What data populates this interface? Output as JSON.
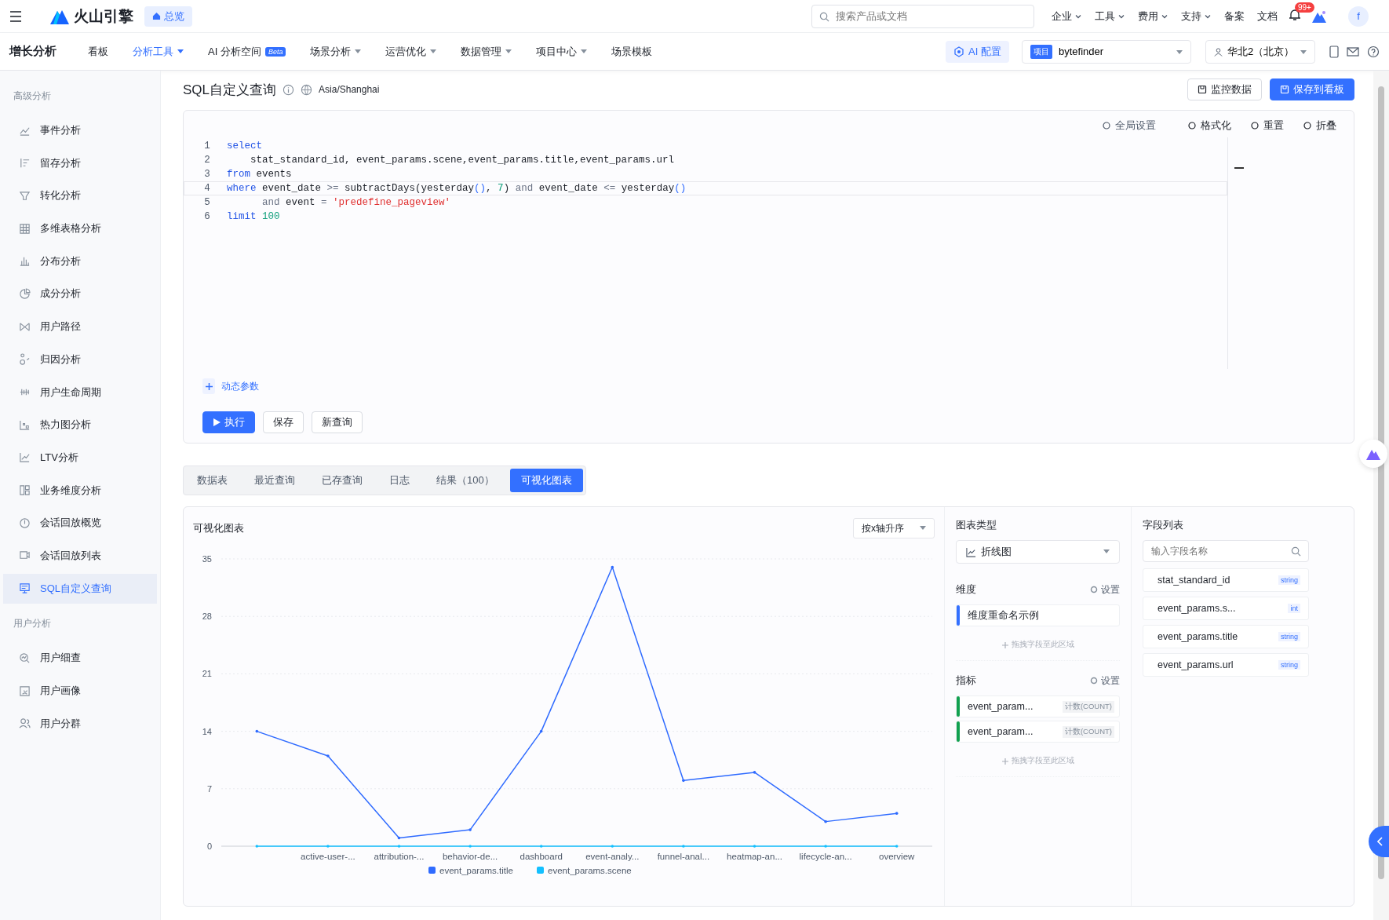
{
  "top_bar": {
    "logo": "火山引擎",
    "home": "总览",
    "search": {
      "placeholder": "搜索产品或文档"
    },
    "menus": [
      {
        "label": "企业",
        "dropdown": true
      },
      {
        "label": "工具",
        "dropdown": true
      },
      {
        "label": "费用",
        "dropdown": true
      },
      {
        "label": "支持",
        "dropdown": true
      },
      {
        "label": "备案",
        "dropdown": false
      },
      {
        "label": "文档",
        "dropdown": false
      }
    ],
    "notification_badge": "99+",
    "avatar": "f"
  },
  "nav": {
    "title": "增长分析",
    "items": [
      {
        "label": "看板",
        "selected": false,
        "dropdown": false
      },
      {
        "label": "分析工具",
        "selected": true,
        "dropdown": true
      },
      {
        "label": "AI 分析空间",
        "badge": "Beta",
        "selected": false,
        "dropdown": false
      },
      {
        "label": "场景分析",
        "selected": false,
        "dropdown": true
      },
      {
        "label": "运营优化",
        "selected": false,
        "dropdown": true
      },
      {
        "label": "数据管理",
        "selected": false,
        "dropdown": true
      },
      {
        "label": "项目中心",
        "selected": false,
        "dropdown": true
      },
      {
        "label": "场景模板",
        "selected": false,
        "dropdown": false
      }
    ],
    "ai_config": "AI 配置",
    "project": {
      "tag": "项目",
      "value": "bytefinder"
    },
    "region": "华北2（北京）"
  },
  "sidebar": {
    "groups": [
      {
        "title": "高级分析",
        "items": [
          {
            "label": "事件分析",
            "selected": false
          },
          {
            "label": "留存分析",
            "selected": false
          },
          {
            "label": "转化分析",
            "selected": false
          },
          {
            "label": "多维表格分析",
            "selected": false
          },
          {
            "label": "分布分析",
            "selected": false
          },
          {
            "label": "成分分析",
            "selected": false
          },
          {
            "label": "用户路径",
            "selected": false
          },
          {
            "label": "归因分析",
            "selected": false
          },
          {
            "label": "用户生命周期",
            "selected": false
          },
          {
            "label": "热力图分析",
            "selected": false
          },
          {
            "label": "LTV分析",
            "selected": false
          },
          {
            "label": "业务维度分析",
            "selected": false
          },
          {
            "label": "会话回放概览",
            "selected": false
          },
          {
            "label": "会话回放列表",
            "selected": false
          },
          {
            "label": "SQL自定义查询",
            "selected": true
          }
        ]
      },
      {
        "title": "用户分析",
        "items": [
          {
            "label": "用户细查",
            "selected": false
          },
          {
            "label": "用户画像",
            "selected": false
          },
          {
            "label": "用户分群",
            "selected": false
          }
        ]
      }
    ]
  },
  "page_header": {
    "title": "SQL自定义查询",
    "timezone": "Asia/Shanghai",
    "buttons": [
      {
        "label": "监控数据",
        "kind": "default"
      },
      {
        "label": "保存到看板",
        "kind": "primary"
      }
    ]
  },
  "editor": {
    "toolbar": [
      "全局设置",
      "格式化",
      "重置",
      "折叠"
    ],
    "lines": [
      {
        "number": "1",
        "current": false,
        "tokens": [
          {
            "kind": "keyword",
            "text": "select"
          }
        ]
      },
      {
        "number": "2",
        "current": false,
        "tokens": [
          {
            "kind": "plain",
            "text": "    stat_standard_id, event_params.scene,event_params.title,event_params.url"
          }
        ]
      },
      {
        "number": "3",
        "current": false,
        "tokens": [
          {
            "kind": "keyword",
            "text": "from"
          },
          {
            "kind": "plain",
            "text": " events"
          }
        ]
      },
      {
        "number": "4",
        "current": true,
        "tokens": [
          {
            "kind": "keyword",
            "text": "where"
          },
          {
            "kind": "plain",
            "text": " event_date "
          },
          {
            "kind": "operator",
            "text": ">="
          },
          {
            "kind": "plain",
            "text": " subtractDays(yesterday"
          },
          {
            "kind": "paren",
            "text": "()"
          },
          {
            "kind": "plain",
            "text": ", "
          },
          {
            "kind": "number",
            "text": "7"
          },
          {
            "kind": "plain",
            "text": ") "
          },
          {
            "kind": "operator",
            "text": "and"
          },
          {
            "kind": "plain",
            "text": " event_date "
          },
          {
            "kind": "operator",
            "text": "<="
          },
          {
            "kind": "plain",
            "text": " yesterday"
          },
          {
            "kind": "paren",
            "text": "()"
          }
        ]
      },
      {
        "number": "5",
        "current": false,
        "tokens": [
          {
            "kind": "operator",
            "text": "      and"
          },
          {
            "kind": "plain",
            "text": " event "
          },
          {
            "kind": "operator",
            "text": "="
          },
          {
            "kind": "string",
            "text": " 'predefine_pageview'"
          }
        ]
      },
      {
        "number": "6",
        "current": false,
        "tokens": [
          {
            "kind": "keyword",
            "text": "limit"
          },
          {
            "kind": "number",
            "text": " 100"
          }
        ]
      }
    ],
    "dynamic_params": "动态参数",
    "actions": [
      {
        "label": "执行",
        "kind": "primary"
      },
      {
        "label": "保存",
        "kind": "default"
      },
      {
        "label": "新查询",
        "kind": "default"
      }
    ]
  },
  "result_tabs": [
    {
      "label": "数据表",
      "selected": false
    },
    {
      "label": "最近查询",
      "selected": false
    },
    {
      "label": "已存查询",
      "selected": false
    },
    {
      "label": "日志",
      "selected": false
    },
    {
      "label": "结果（100）",
      "selected": false
    },
    {
      "label": "可视化图表",
      "selected": true
    }
  ],
  "chart_panel": {
    "title": "可视化图表",
    "sort": "按x轴升序",
    "chart_data": {
      "type": "line",
      "categories": [
        null,
        "active-user-...",
        "attribution-...",
        "behavior-de...",
        "dashboard",
        "event-analy...",
        "funnel-anal...",
        "heatmap-an...",
        "lifecycle-an...",
        "overview"
      ],
      "series": [
        {
          "name": "event_params.title",
          "color": "#2f6bff",
          "values": [
            14,
            11,
            1,
            2,
            14,
            34,
            8,
            9,
            3,
            4
          ]
        },
        {
          "name": "event_params.scene",
          "color": "#14c0ff",
          "values": [
            0,
            0,
            0,
            0,
            0,
            0,
            0,
            0,
            0,
            0
          ]
        }
      ],
      "ylim": [
        0,
        35
      ],
      "yticks": [
        0,
        7,
        14,
        21,
        28,
        35
      ],
      "grid": true,
      "legend": true
    }
  },
  "config": {
    "chart_type": {
      "title": "图表类型",
      "value": "折线图"
    },
    "dimensions": {
      "title": "维度",
      "settings": "设置",
      "items": [
        {
          "label": "维度重命名示例",
          "color": "#3370ff"
        }
      ],
      "drop_hint": "拖拽字段至此区域"
    },
    "metrics": {
      "title": "指标",
      "settings": "设置",
      "items": [
        {
          "label": "event_param...",
          "aggregation": "计数(COUNT)",
          "color": "#12a150"
        },
        {
          "label": "event_param...",
          "aggregation": "计数(COUNT)",
          "color": "#12a150"
        }
      ],
      "drop_hint": "拖拽字段至此区域"
    }
  },
  "fields": {
    "title": "字段列表",
    "placeholder": "输入字段名称",
    "items": [
      {
        "name": "stat_standard_id",
        "type": "string"
      },
      {
        "name": "event_params.s...",
        "type": "int"
      },
      {
        "name": "event_params.title",
        "type": "string"
      },
      {
        "name": "event_params.url",
        "type": "string"
      }
    ]
  }
}
